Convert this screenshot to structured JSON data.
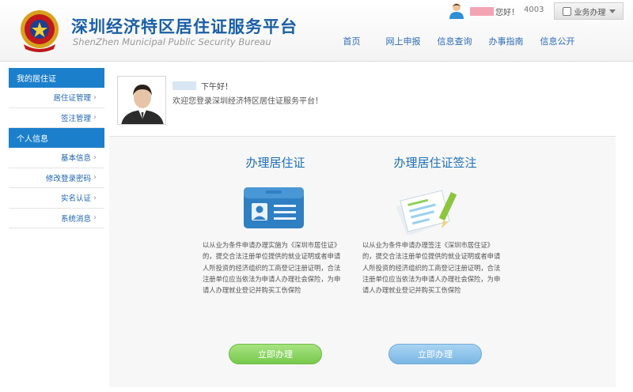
{
  "header": {
    "title": "深圳经济特区居住证服务平台",
    "subtitle": "ShenZhen Municipal Public Security Bureau",
    "user_greeting": "您好！",
    "message_count": "4003",
    "biz_menu": "业务办理"
  },
  "nav": {
    "items": [
      "首页",
      "网上申报",
      "信息查询",
      "办事指南",
      "信息公开"
    ]
  },
  "sidebar": {
    "section1_title": "我的居住证",
    "section1_items": [
      "居住证管理",
      "签注管理"
    ],
    "section2_title": "个人信息",
    "section2_items": [
      "基本信息",
      "修改登录密码",
      "实名认证",
      "系统消息"
    ]
  },
  "profile": {
    "greeting": "下午好！",
    "welcome": "欢迎您登录深圳经济特区居住证服务平台！"
  },
  "cards": [
    {
      "title": "办理居住证",
      "description": "以从业为条件申请办理实施为《深圳市居住证》的，提交合法注册单位提供的就业证明或者申请人所投资的经济组织的工商登记注册证明，合法注册单位应当依法为申请人办理社会保险，为申请人办理就业登记并购买工伤保险",
      "button": "立即办理"
    },
    {
      "title": "办理居住证签注",
      "description": "以从业为条件申请办理签注《深圳市居住证》的，提交合法注册单位提供的就业证明或者申请人所投资的经济组织的工商登记注册证明，合法注册单位应当依法为申请人办理社会保险，为申请人办理就业登记并购买工伤保险",
      "button": "立即办理"
    }
  ],
  "colors": {
    "brand_blue": "#1a5fa6",
    "sidebar_blue": "#1c7fcc",
    "button_green": "#77c94c",
    "button_blue": "#7ab6e4"
  }
}
